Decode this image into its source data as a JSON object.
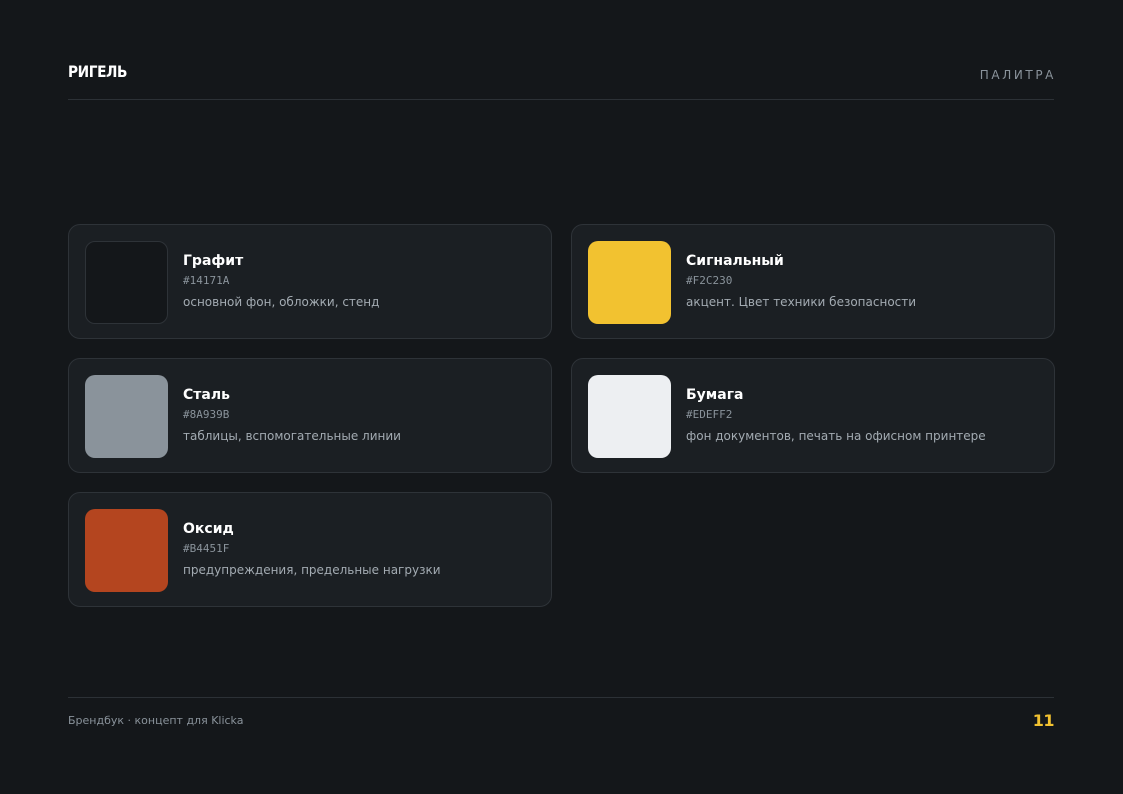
{
  "header": {
    "brand": "РИГЕЛЬ",
    "section": "ПАЛИТРА"
  },
  "palette": [
    {
      "name": "Графит",
      "hex": "#14171A",
      "color": "#14171a",
      "description": "основной фон, обложки, стенд"
    },
    {
      "name": "Сигнальный",
      "hex": "#F2C230",
      "color": "#f2c230",
      "description": "акцент. Цвет техники безопасности"
    },
    {
      "name": "Сталь",
      "hex": "#8A939B",
      "color": "#8a939b",
      "description": "таблицы, вспомогательные линии"
    },
    {
      "name": "Бумага",
      "hex": "#EDEFF2",
      "color": "#edeff2",
      "description": "фон документов, печать на офисном принтере"
    },
    {
      "name": "Оксид",
      "hex": "#B4451F",
      "color": "#b4451f",
      "description": "предупреждения, предельные нагрузки"
    }
  ],
  "footer": {
    "text": "Брендбук · концепт для Klicka",
    "page": "11"
  }
}
